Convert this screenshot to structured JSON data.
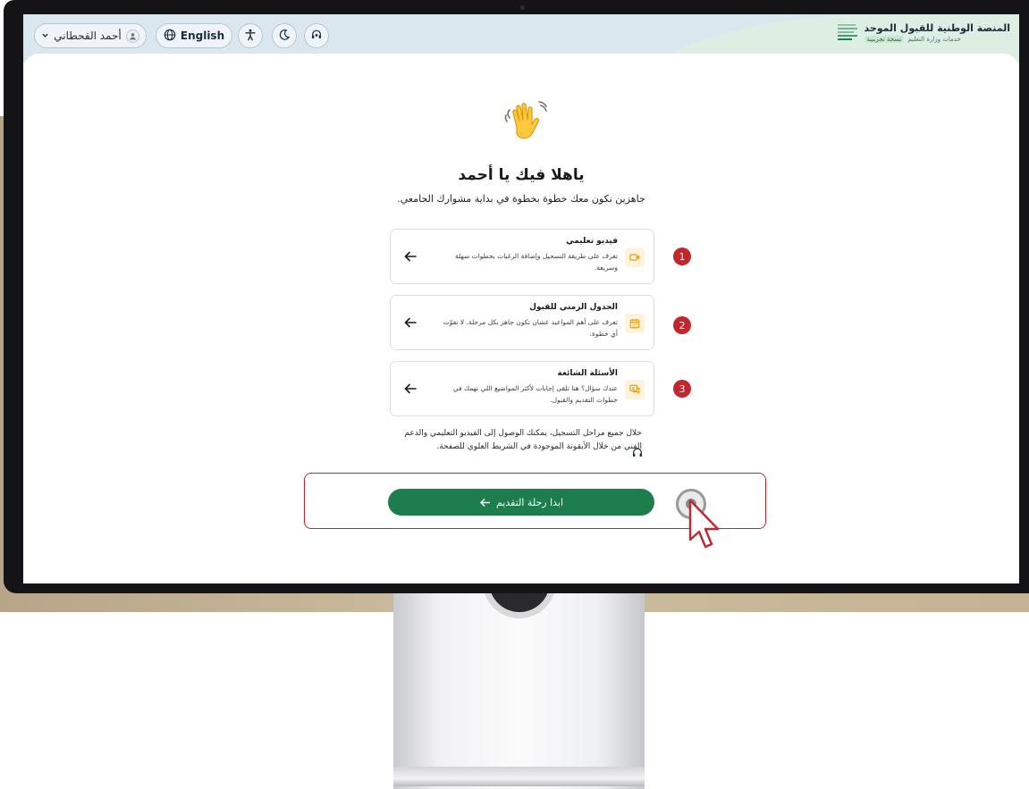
{
  "header": {
    "platform_title": "المنصة الوطنية للقبول الموحد",
    "platform_subtitle": "خدمات وزارة التعليم",
    "version_badge": "نسخة تجريبية",
    "user_name": "أحمد القحطاني",
    "language_label": "English"
  },
  "welcome": {
    "title": "ياهلا فيك يا أحمد",
    "subtitle": "جاهزين نكون معك خطوة بخطوة في بداية مشوارك الجامعي."
  },
  "steps": [
    {
      "number": "1",
      "title": "فيديو تعليمي",
      "description": "تعرف على طريقة التسجيل وإضافة الرغبات بخطوات سهلة وسريعة.",
      "icon": "video-icon"
    },
    {
      "number": "2",
      "title": "الجدول الزمني للقبول",
      "description": "تعرف على أهم المواعيد عشان تكون جاهز بكل مرحلة. لا تفوّت أي خطوة.",
      "icon": "calendar-icon"
    },
    {
      "number": "3",
      "title": "الأسئلة الشائعة",
      "description": "عندك سؤال؟ هنا تلقى إجابات لأكثر المواضيع اللي تهمك في خطوات التقديم والقبول.",
      "icon": "chat-icon"
    }
  ],
  "note": "خلال جميع مراحل التسجيل، يمكنك الوصول إلى الفيديو التعليمي والدعم الفني من خلال الأيقونة الموجودة في الشريط العلوي للصفحة.",
  "cta_label": "ابدا رحلة التقديم",
  "colors": {
    "primary_green": "#1d7d4d",
    "step_red": "#c1272d",
    "icon_amber": "#e0a11b",
    "header_blue": "#dbe7ef",
    "header_green": "#dcefe2"
  }
}
